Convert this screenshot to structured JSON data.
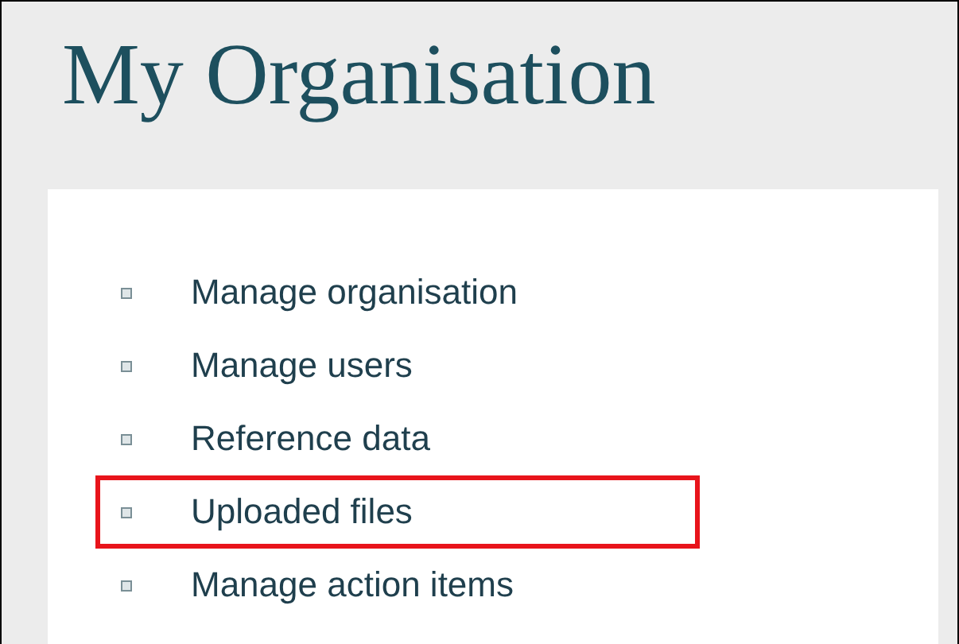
{
  "page": {
    "title": "My Organisation"
  },
  "menu": [
    {
      "label": "Manage organisation",
      "highlighted": false
    },
    {
      "label": "Manage users",
      "highlighted": false
    },
    {
      "label": "Reference data",
      "highlighted": false
    },
    {
      "label": "Uploaded files",
      "highlighted": true
    },
    {
      "label": "Manage action items",
      "highlighted": false
    }
  ]
}
